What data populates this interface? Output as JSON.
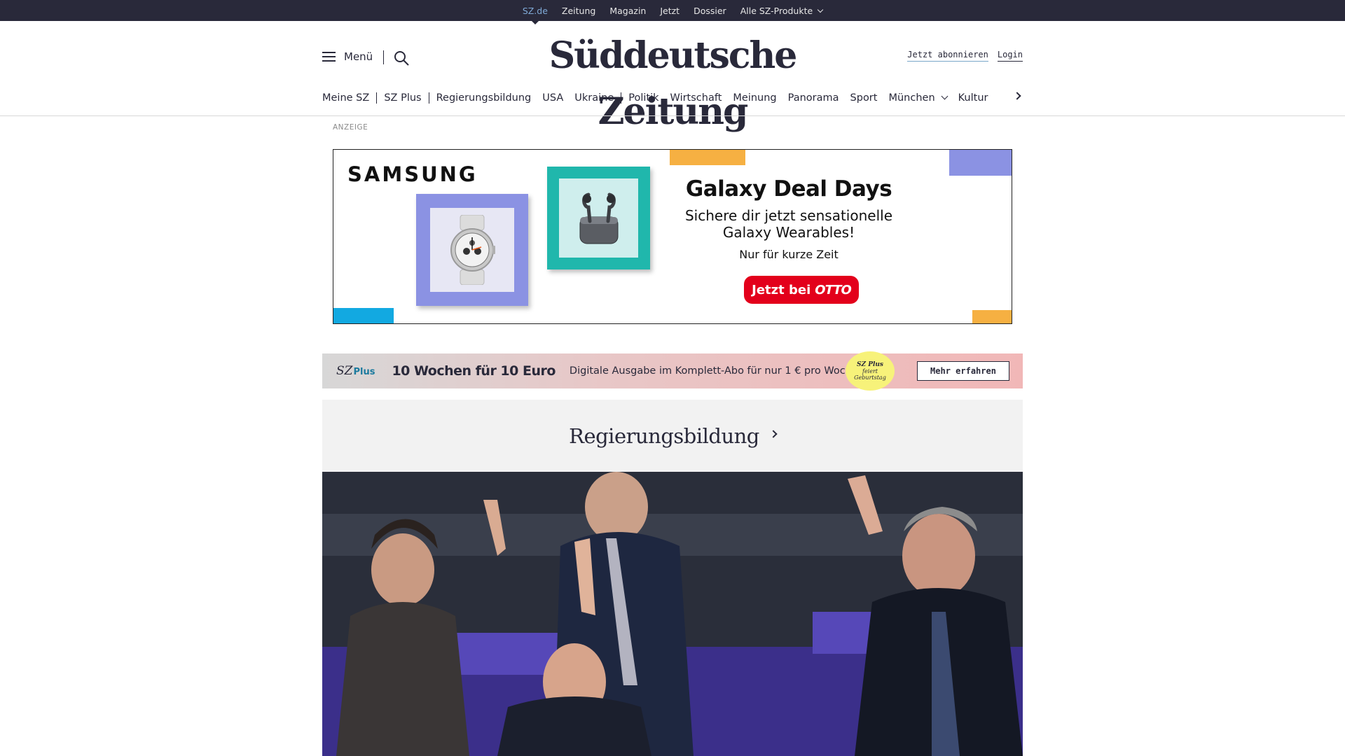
{
  "topbar": {
    "items": [
      "SZ.de",
      "Zeitung",
      "Magazin",
      "Jetzt",
      "Dossier",
      "Alle SZ-Produkte"
    ]
  },
  "header": {
    "menu_label": "Menü",
    "logo": "Süddeutsche Zeitung",
    "subscribe": "Jetzt abonnieren",
    "login": "Login"
  },
  "ressorts": [
    "Meine SZ",
    "SZ Plus",
    "Regierungsbildung",
    "USA",
    "Ukraine",
    "Politik",
    "Wirtschaft",
    "Meinung",
    "Panorama",
    "Sport",
    "München",
    "Kultur"
  ],
  "ad": {
    "label": "ANZEIGE",
    "brand": "SAMSUNG",
    "headline": "Galaxy Deal Days",
    "sub_line1": "Sichere dir jetzt sensationelle",
    "sub_line2": "Galaxy Wearables!",
    "note": "Nur für kurze Zeit",
    "cta_prefix": "Jetzt bei",
    "cta_brand": "OTTO",
    "colors": {
      "cta": "#e3001b",
      "watch_frame": "#8b92e3",
      "buds_frame": "#20b7ac",
      "orange": "#f6b042",
      "blue": "#12a9e1"
    }
  },
  "promo": {
    "logo_sz": "SZ",
    "logo_plus": "Plus",
    "title": "10 Wochen für 10 Euro",
    "text": "Digitale Ausgabe im Komplett-Abo für nur 1 € pro Woche.",
    "badge_line1": "SZ Plus",
    "badge_line2": "feiert",
    "badge_line3": "Geburtstag",
    "button": "Mehr erfahren"
  },
  "teaser": {
    "title": "Regierungsbildung"
  },
  "colors": {
    "brand_dark": "#29293a",
    "topbar_active": "#7fa9d6",
    "teaser_bg": "#f2f2f2"
  }
}
